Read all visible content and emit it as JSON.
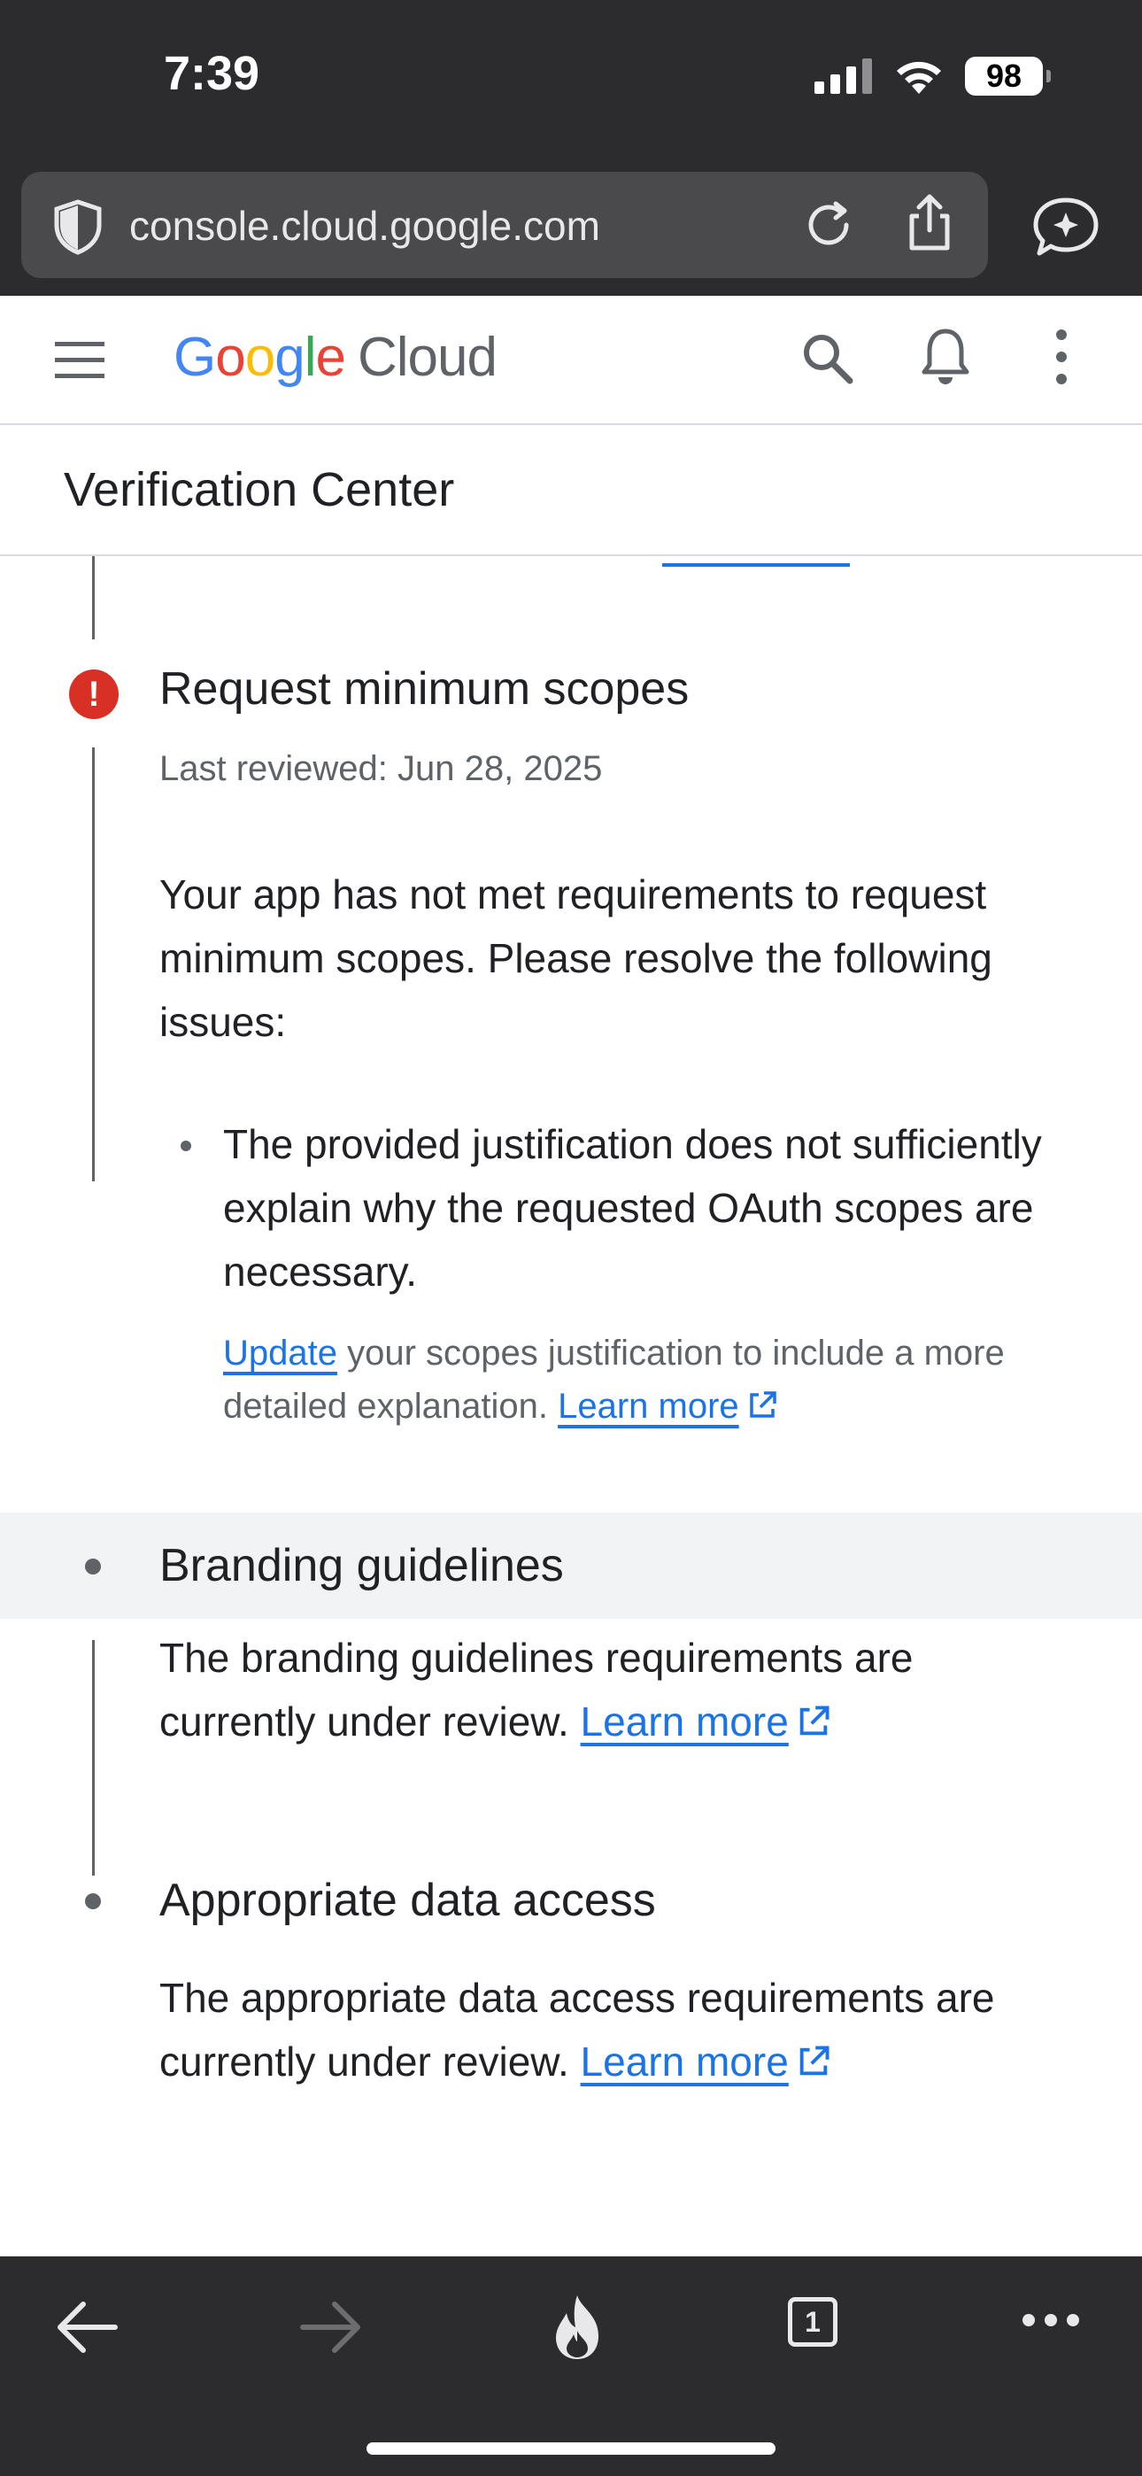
{
  "status_bar": {
    "time": "7:39",
    "battery": "98"
  },
  "browser": {
    "url": "console.cloud.google.com",
    "icons": [
      "shield-icon",
      "reload-icon",
      "share-icon",
      "ai-assistant-icon"
    ]
  },
  "header": {
    "logo_google": [
      "G",
      "o",
      "o",
      "g",
      "l",
      "e"
    ],
    "logo_cloud": "Cloud",
    "icons": [
      "menu-icon",
      "search-icon",
      "bell-icon",
      "more-vert-icon"
    ]
  },
  "page": {
    "title": "Verification Center"
  },
  "sections": {
    "min_scopes": {
      "title": "Request minimum scopes",
      "last_reviewed": "Last reviewed: Jun 28, 2025",
      "description": "Your app has not met requirements to request minimum scopes. Please resolve the following issues:",
      "issue": "The provided justification does not sufficiently explain why the requested OAuth scopes are necessary.",
      "hint_link": "Update",
      "hint_text": " your scopes justification to include a more detailed explanation. ",
      "learn_more": "Learn more",
      "status_icon": "error-icon"
    },
    "branding": {
      "title": "Branding guidelines",
      "description": "The branding guidelines requirements are currently under review. ",
      "learn_more": "Learn more"
    },
    "data_access": {
      "title": "Appropriate data access",
      "description": "The appropriate data access requirements are currently under review. ",
      "learn_more": "Learn more"
    }
  },
  "toolbar": {
    "icons": [
      "back-arrow-icon",
      "forward-arrow-icon",
      "fire-icon",
      "tabs-icon",
      "more-horiz-icon"
    ],
    "tab_count": "1"
  },
  "colors": {
    "link": "#1a73e8",
    "error": "#d93025",
    "dark_chrome": "#2c2c2e"
  }
}
